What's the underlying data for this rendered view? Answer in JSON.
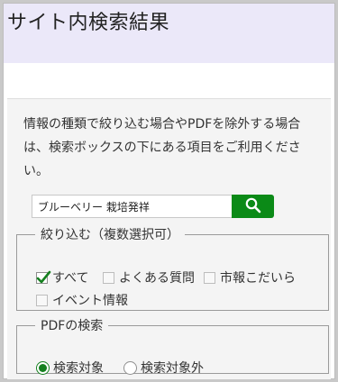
{
  "header": {
    "title": "サイト内検索結果"
  },
  "intro_text": "情報の種類で絞り込む場合やPDFを除外する場合は、検索ボックスの下にある項目をご利用ください。",
  "search": {
    "value": "ブルーベリー 栽培発祥",
    "button_icon": "search-icon"
  },
  "filter": {
    "legend": "絞り込む（複数選択可）",
    "options": [
      {
        "label": "すべて",
        "checked": true
      },
      {
        "label": "よくある質問",
        "checked": false
      },
      {
        "label": "市報こだいら",
        "checked": false
      },
      {
        "label": "イベント情報",
        "checked": false
      }
    ]
  },
  "pdf": {
    "legend": "PDFの検索",
    "options": [
      {
        "label": "検索対象",
        "selected": true
      },
      {
        "label": "検索対象外",
        "selected": false
      }
    ]
  },
  "colors": {
    "header_bg": "#ebe8f9",
    "accent": "#0b8a17"
  }
}
